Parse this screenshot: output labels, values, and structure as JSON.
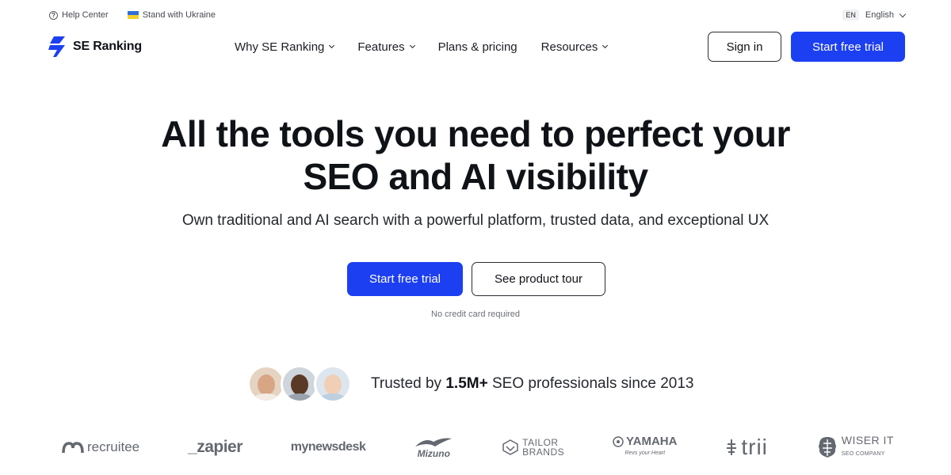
{
  "utility": {
    "help_center": "Help Center",
    "ukraine": "Stand with Ukraine",
    "lang_code": "EN",
    "lang_label": "English"
  },
  "header": {
    "brand": "SE Ranking",
    "nav": [
      "Why SE Ranking",
      "Features",
      "Plans & pricing",
      "Resources"
    ],
    "sign_in": "Sign in",
    "start_trial": "Start free trial"
  },
  "hero": {
    "title_line1": "All the tools you need to perfect your",
    "title_line2": "SEO and AI visibility",
    "subtitle": "Own traditional and AI search with a powerful platform, trusted data, and exceptional UX",
    "cta_trial": "Start free trial",
    "cta_tour": "See product tour",
    "note": "No credit card required"
  },
  "trusted": {
    "prefix": "Trusted by",
    "count": "1.5M+",
    "suffix": "SEO professionals since 2013"
  },
  "logos": {
    "recruitee": "recruitee",
    "zapier": "_zapier",
    "newsdesk": "mynewsdesk",
    "mizuno": "Mizuno",
    "tailor_1": "TAILOR",
    "tailor_2": "BRANDS",
    "yamaha": "YAMAHA",
    "yamaha_tag": "Revs your Heart",
    "trii": "trii",
    "wiser_1": "WISER IT",
    "wiser_2": "SEO COMPANY"
  },
  "colors": {
    "accent": "#1d3ff2",
    "text": "#0f1217",
    "muted": "#646870"
  },
  "icons": [
    "help-circle-icon",
    "ukraine-flag-icon",
    "chevron-down-icon",
    "se-ranking-logo"
  ]
}
